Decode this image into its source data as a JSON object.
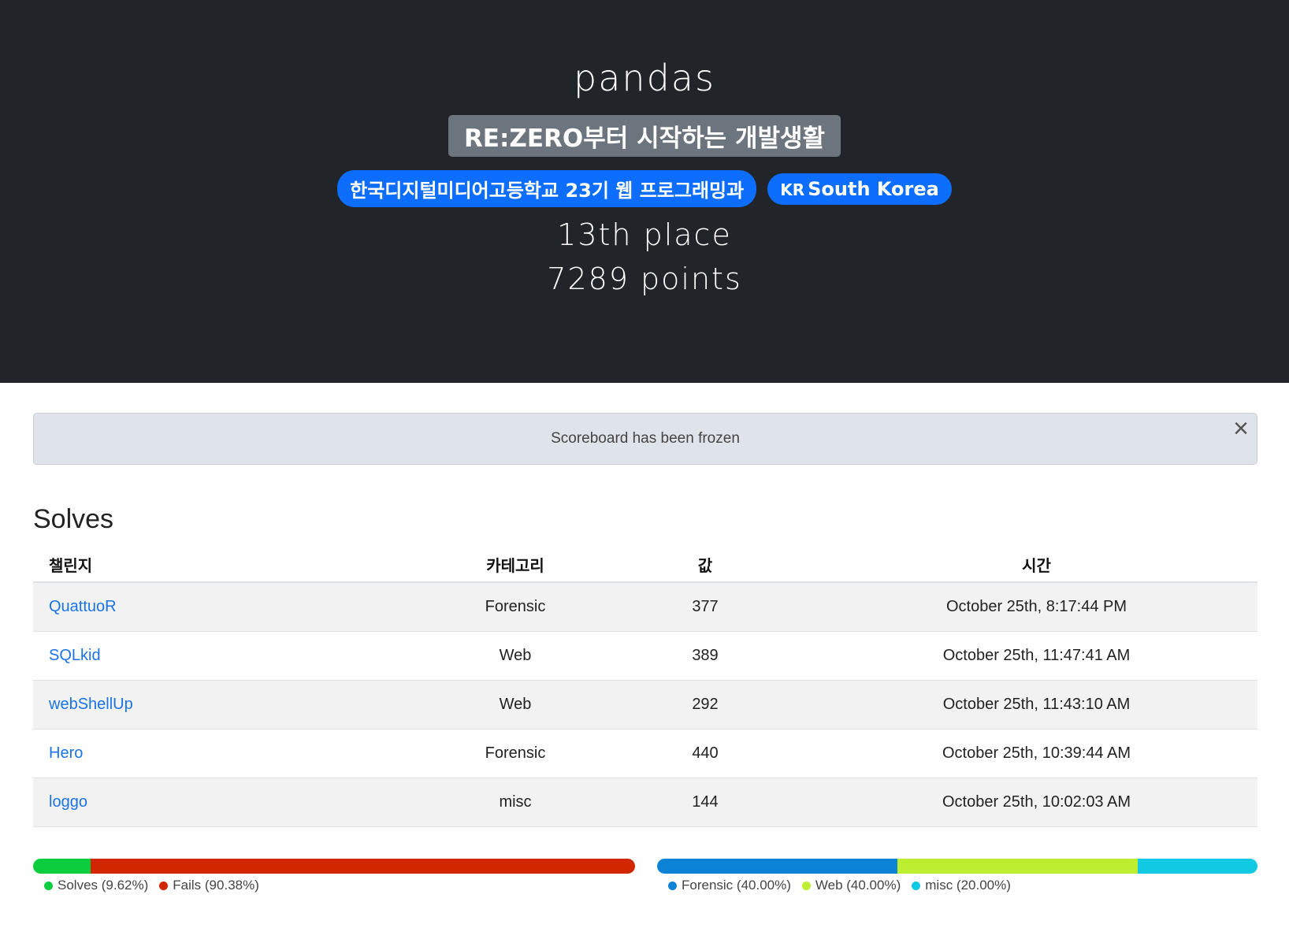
{
  "team": {
    "name": "pandas",
    "affiliation": "RE:ZERO부터 시작하는 개발생활",
    "school": "한국디지털미디어고등학교 23기 웹 프로그래밍과",
    "country_code": "KR",
    "country": "South Korea",
    "place": "13th place",
    "points": "7289 points"
  },
  "alert": {
    "message": "Scoreboard has been frozen",
    "close": "×"
  },
  "solves": {
    "title": "Solves",
    "headers": [
      "챌린지",
      "카테고리",
      "값",
      "시간"
    ],
    "rows": [
      {
        "challenge": "QuattuoR",
        "category": "Forensic",
        "value": "377",
        "time": "October 25th, 8:17:44 PM"
      },
      {
        "challenge": "SQLkid",
        "category": "Web",
        "value": "389",
        "time": "October 25th, 11:47:41 AM"
      },
      {
        "challenge": "webShellUp",
        "category": "Web",
        "value": "292",
        "time": "October 25th, 11:43:10 AM"
      },
      {
        "challenge": "Hero",
        "category": "Forensic",
        "value": "440",
        "time": "October 25th, 10:39:44 AM"
      },
      {
        "challenge": "loggo",
        "category": "misc",
        "value": "144",
        "time": "October 25th, 10:02:03 AM"
      }
    ]
  },
  "solve_bar": {
    "segments": [
      {
        "label": "Solves (9.62%)",
        "percent": 9.62,
        "color": "#0bcd3d"
      },
      {
        "label": "Fails (90.38%)",
        "percent": 90.38,
        "color": "#d12600"
      }
    ]
  },
  "category_bar": {
    "segments": [
      {
        "label": "Forensic (40.00%)",
        "percent": 40.0,
        "color": "#0c83d4"
      },
      {
        "label": "Web (40.00%)",
        "percent": 40.0,
        "color": "#bdee30"
      },
      {
        "label": "misc (20.00%)",
        "percent": 20.0,
        "color": "#12c9e4"
      }
    ]
  }
}
